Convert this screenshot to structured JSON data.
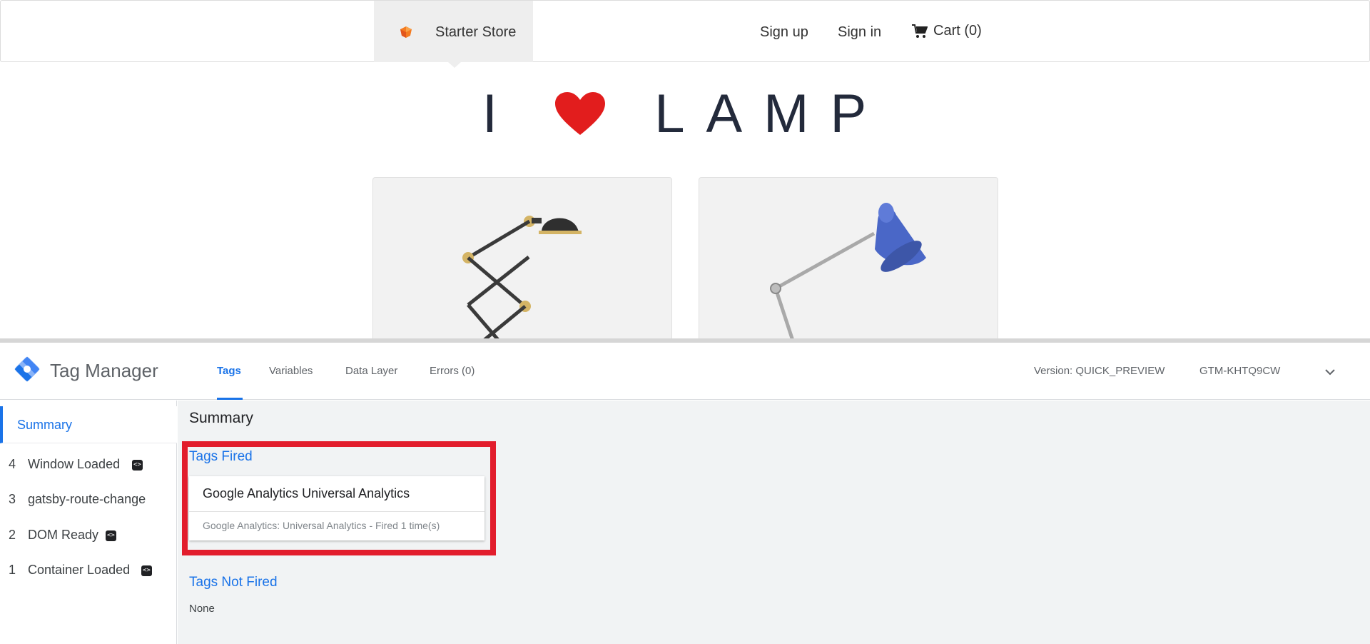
{
  "store": {
    "brand_name": "Starter Store",
    "nav": {
      "sign_up": "Sign up",
      "sign_in": "Sign in",
      "cart": "Cart (0)"
    }
  },
  "hero": {
    "left": "I",
    "right": "LAMP"
  },
  "tag_manager": {
    "title": "Tag Manager",
    "tabs": [
      {
        "label": "Tags",
        "active": true
      },
      {
        "label": "Variables",
        "active": false
      },
      {
        "label": "Data Layer",
        "active": false
      },
      {
        "label": "Errors (0)",
        "active": false
      }
    ],
    "version": "Version: QUICK_PREVIEW",
    "container_id": "GTM-KHTQ9CW",
    "sidebar": {
      "summary": "Summary",
      "events": [
        {
          "num": "4",
          "label": "Window Loaded",
          "has_icon": true
        },
        {
          "num": "3",
          "label": "gatsby-route-change",
          "has_icon": false
        },
        {
          "num": "2",
          "label": "DOM Ready",
          "has_icon": true
        },
        {
          "num": "1",
          "label": "Container Loaded",
          "has_icon": true
        }
      ]
    },
    "main": {
      "title": "Summary",
      "tags_fired_label": "Tags Fired",
      "tags_fired": [
        {
          "name": "Google Analytics Universal Analytics",
          "detail": "Google Analytics: Universal Analytics - Fired 1 time(s)"
        }
      ],
      "tags_not_fired_label": "Tags Not Fired",
      "tags_not_fired_value": "None"
    }
  },
  "colors": {
    "accent": "#1a73e8",
    "highlight": "#e21d2c",
    "heart": "#e21d1d"
  }
}
